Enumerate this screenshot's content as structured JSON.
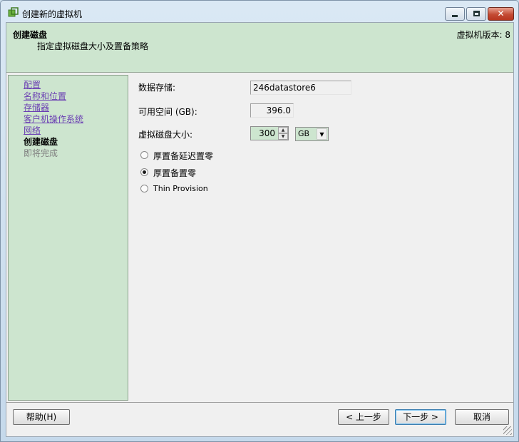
{
  "window": {
    "title": "创建新的虚拟机",
    "close_glyph": "✕"
  },
  "header": {
    "title": "创建磁盘",
    "subtitle": "指定虚拟磁盘大小及置备策略",
    "version": "虚拟机版本: 8"
  },
  "nav": {
    "items": [
      {
        "label": "配置",
        "state": "done"
      },
      {
        "label": "名称和位置",
        "state": "done"
      },
      {
        "label": "存储器",
        "state": "done"
      },
      {
        "label": "客户机操作系统",
        "state": "done"
      },
      {
        "label": "网络",
        "state": "done"
      },
      {
        "label": "创建磁盘",
        "state": "current"
      },
      {
        "label": "即将完成",
        "state": "future"
      }
    ]
  },
  "form": {
    "datastore_label": "数据存储:",
    "datastore_value": "246datastore6",
    "free_space_label": "可用空间 (GB):",
    "free_space_value": "396.0",
    "disk_size_label": "虚拟磁盘大小:",
    "disk_size_value": "300",
    "unit_value": "GB",
    "radios": [
      {
        "label": "厚置备延迟置零",
        "checked": false
      },
      {
        "label": "厚置备置零",
        "checked": true
      },
      {
        "label": "Thin Provision",
        "checked": false
      }
    ]
  },
  "buttons": {
    "help": "帮助(H)",
    "back": "< 上一步",
    "next": "下一步 >",
    "cancel": "取消"
  },
  "colors": {
    "panel_green": "#cde5cf",
    "link_purple": "#6b3fb3",
    "window_blue": "#cfe1ef"
  }
}
